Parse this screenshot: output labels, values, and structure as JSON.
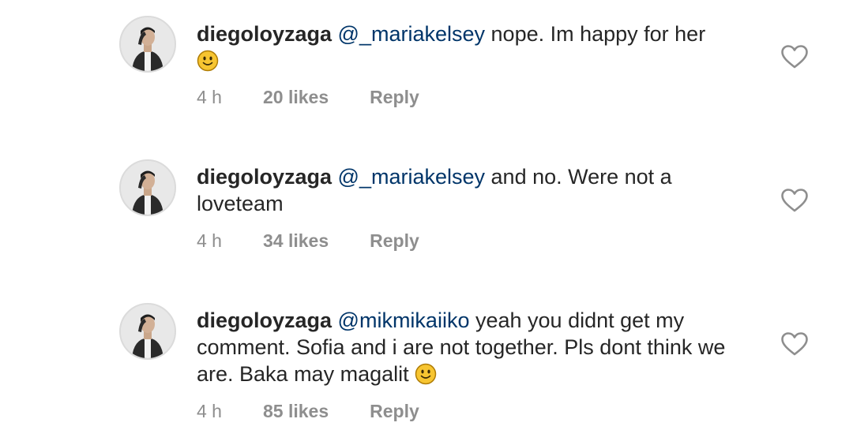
{
  "comments": [
    {
      "username": "diegoloyzaga",
      "mention": "@_mariakelsey",
      "text": "nope. Im happy for her",
      "emoji": "slightly-smiling-face",
      "time": "4 h",
      "likes": "20 likes",
      "reply_label": "Reply"
    },
    {
      "username": "diegoloyzaga",
      "mention": "@_mariakelsey",
      "text": "and no. Were not a loveteam",
      "time": "4 h",
      "likes": "34 likes",
      "reply_label": "Reply"
    },
    {
      "username": "diegoloyzaga",
      "mention": "@mikmikaiiko",
      "text": "yeah you didnt get my comment. Sofia and i are not together. Pls dont think we are. Baka may magalit",
      "emoji": "slightly-smiling-face",
      "time": "4 h",
      "likes": "85 likes",
      "reply_label": "Reply"
    }
  ],
  "colors": {
    "text": "#262626",
    "mention": "#003569",
    "meta": "#8e8e8e",
    "emoji": "#f7c531"
  }
}
